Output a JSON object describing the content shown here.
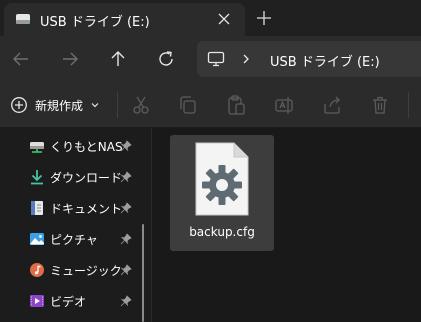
{
  "window": {
    "tab_title": "USB ドライブ (E:)",
    "icons": {
      "drive": "drive-icon",
      "close": "close-icon",
      "new_tab": "plus-icon"
    }
  },
  "navigation": {
    "back": "arrow-left-icon",
    "forward": "arrow-right-icon",
    "up": "arrow-up-icon",
    "refresh": "refresh-icon",
    "address": {
      "icon": "monitor-icon",
      "path": "USB ドライブ (E:)"
    }
  },
  "toolbar": {
    "new_label": "新規作成",
    "commands": [
      "cut-icon",
      "copy-icon",
      "paste-icon",
      "rename-icon",
      "share-icon",
      "delete-icon"
    ]
  },
  "sidebar": {
    "items": [
      {
        "label": "くりもとNAS (A",
        "icon": "network-drive-icon",
        "pinned": true
      },
      {
        "label": "ダウンロード",
        "icon": "download-icon",
        "pinned": true
      },
      {
        "label": "ドキュメント",
        "icon": "document-icon",
        "pinned": true
      },
      {
        "label": "ピクチャ",
        "icon": "pictures-icon",
        "pinned": true
      },
      {
        "label": "ミュージック",
        "icon": "music-icon",
        "pinned": true
      },
      {
        "label": "ビデオ",
        "icon": "video-icon",
        "pinned": true
      }
    ]
  },
  "content": {
    "files": [
      {
        "name": "backup.cfg",
        "icon": "config-file-icon",
        "selected": true
      }
    ]
  },
  "colors": {
    "background": "#191919",
    "chrome": "#2b2b2b",
    "selection": "#3d3d3d",
    "download_accent": "#4cc2a3",
    "pictures_accent": "#3aa0e8",
    "music_accent": "#e06d48",
    "video_accent": "#8e44c8"
  }
}
